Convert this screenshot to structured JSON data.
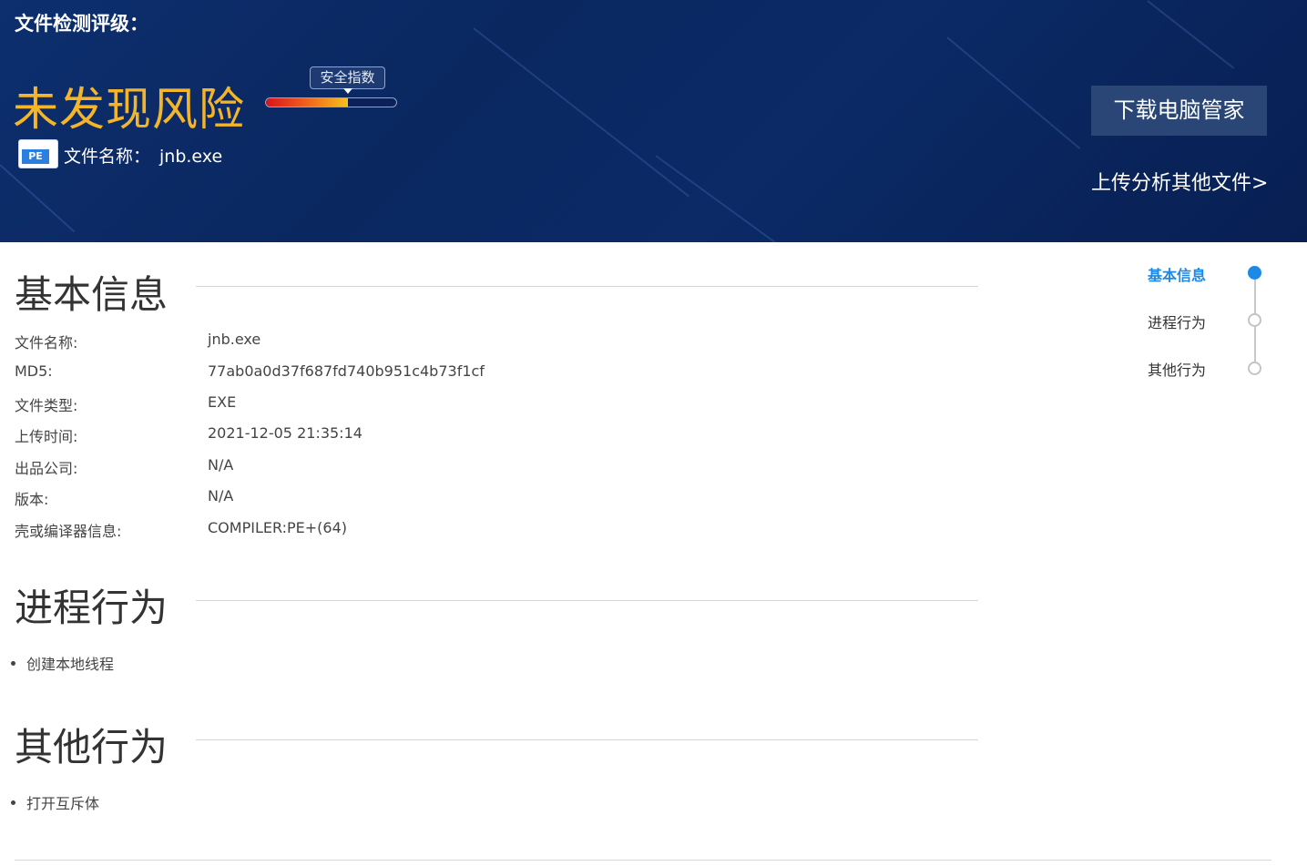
{
  "header": {
    "title": "文件检测评级：",
    "verdict": "未发现风险",
    "gauge_label": "安全指数",
    "gauge_level": 0.63,
    "file_label": "文件名称：",
    "file_name": "jnb.exe",
    "file_icon_text": "PE",
    "download_button": "下载电脑管家",
    "upload_link": "上传分析其他文件>"
  },
  "sections": {
    "basic": {
      "title": "基本信息",
      "rows": [
        {
          "label": "文件名称:",
          "value": "jnb.exe"
        },
        {
          "label": "MD5:",
          "value": "77ab0a0d37f687fd740b951c4b73f1cf"
        },
        {
          "label": "文件类型:",
          "value": "EXE"
        },
        {
          "label": "上传时间:",
          "value": "2021-12-05 21:35:14"
        },
        {
          "label": "出品公司:",
          "value": "N/A"
        },
        {
          "label": "版本:",
          "value": "N/A"
        },
        {
          "label": "壳或编译器信息:",
          "value": "COMPILER:PE+(64)"
        }
      ]
    },
    "process": {
      "title": "进程行为",
      "items": [
        "创建本地线程"
      ]
    },
    "other": {
      "title": "其他行为",
      "items": [
        "打开互斥体"
      ]
    }
  },
  "side_nav": {
    "items": [
      {
        "label": "基本信息",
        "active": true
      },
      {
        "label": "进程行为",
        "active": false
      },
      {
        "label": "其他行为",
        "active": false
      }
    ]
  },
  "colors": {
    "banner": "#0b2a66",
    "verdict": "#f4b52b",
    "accent": "#1e88e5"
  }
}
